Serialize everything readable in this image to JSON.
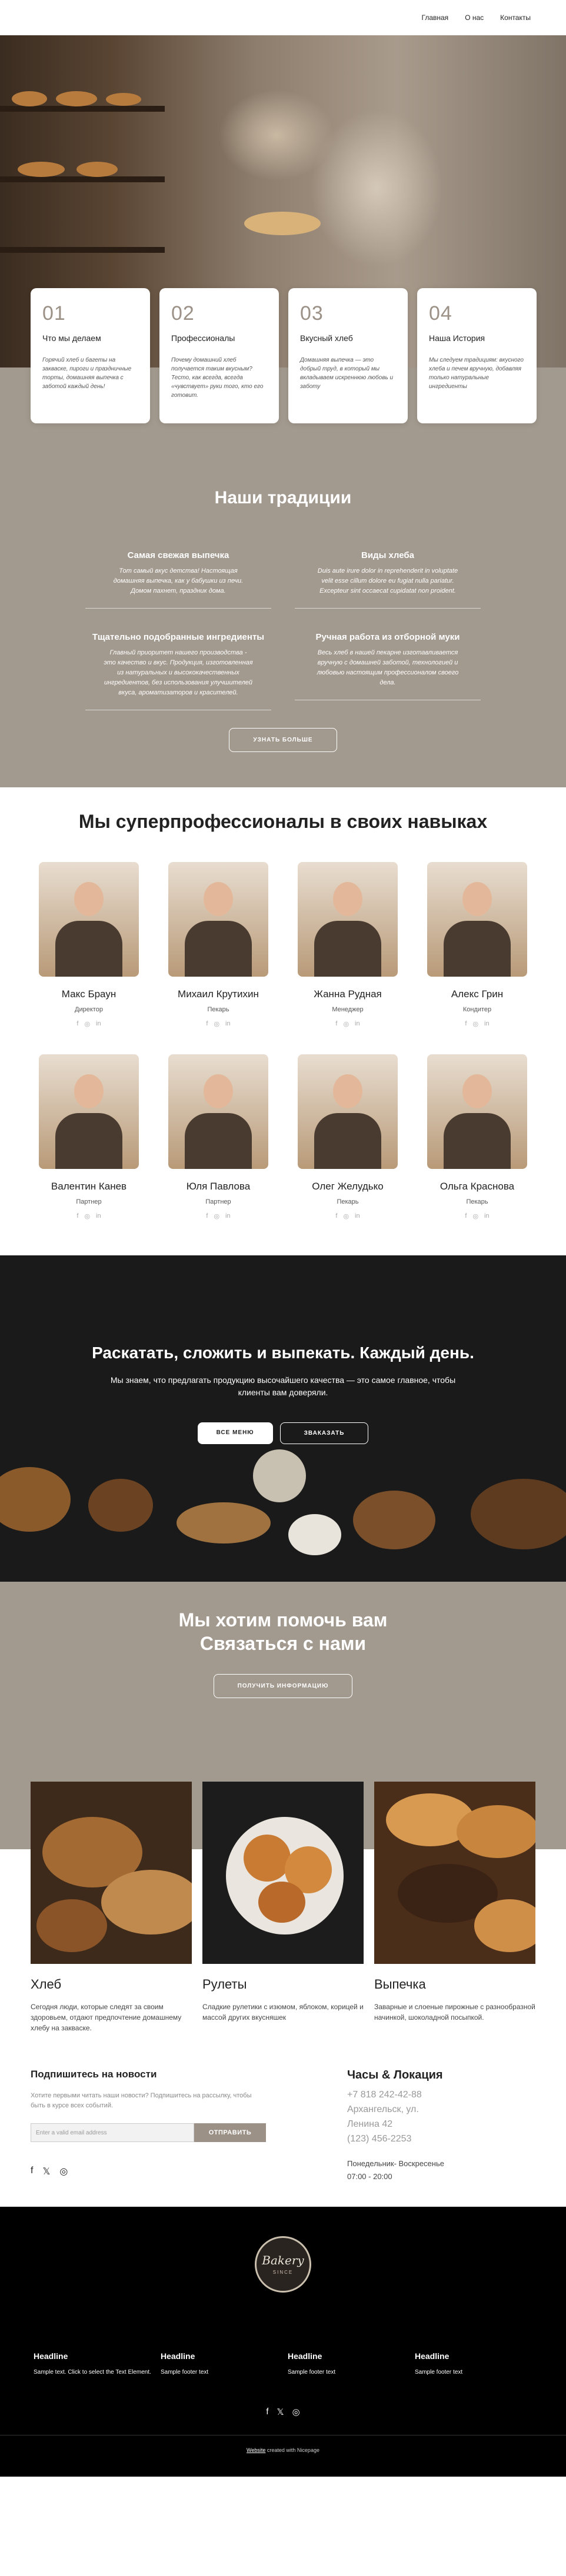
{
  "nav": {
    "items": [
      "Главная",
      "О нас",
      "Контакты"
    ]
  },
  "features": [
    {
      "num": "01",
      "title": "Что мы делаем",
      "text": "Горячий хлеб и багеты на закваске, пироги и праздничные торты, домашняя выпечка с заботой каждый день!"
    },
    {
      "num": "02",
      "title": "Профессионалы",
      "text": "Почему домашний хлеб получается таким вкусным? Тесто, как всегда, всегда «чувствует» руки того, кто его готовит."
    },
    {
      "num": "03",
      "title": "Вкусный хлеб",
      "text": "Домашняя выпечка — это добрый труд, в который мы вкладываем искреннюю любовь и заботу"
    },
    {
      "num": "04",
      "title": "Наша История",
      "text": "Мы следуем традициям: вкусного хлеба и печем вручную, добавляя только натуральные ингредиенты"
    }
  ],
  "traditions": {
    "title": "Наши традиции",
    "items": [
      {
        "title": "Самая свежая выпечка",
        "text": "Тот самый вкус детства! Настоящая домашняя выпечка, как у бабушки из печи. Домом пахнет, праздник дома."
      },
      {
        "title": "Виды хлеба",
        "text": "Duis aute irure dolor in reprehenderit in voluptate velit esse cillum dolore eu fugiat nulla pariatur. Excepteur sint occaecat cupidatat non proident."
      },
      {
        "title": "Тщательно подобранные ингредиенты",
        "text": "Главный приоритет нашего производства - это качество и вкус. Продукция, изготовленная из натуральных и высококачественных ингредиентов, без использования улучшителей вкуса, ароматизаторов и красителей."
      },
      {
        "title": "Ручная работа из отборной муки",
        "text": "Весь хлеб в нашей пекарне изготавливается вручную с домашней заботой, технологией и любовью настоящим профессионалом своего дела."
      }
    ],
    "button": "УЗНАТЬ БОЛЬШЕ"
  },
  "team": {
    "title": "Мы суперпрофессионалы в своих навыках",
    "members": [
      {
        "name": "Макс Браун",
        "role": "Директор"
      },
      {
        "name": "Михаил Крутихин",
        "role": "Пекарь"
      },
      {
        "name": "Жанна Рудная",
        "role": "Менеджер"
      },
      {
        "name": "Алекс Грин",
        "role": "Кондитер"
      },
      {
        "name": "Валентин Канев",
        "role": "Партнер"
      },
      {
        "name": "Юля Павлова",
        "role": "Партнер"
      },
      {
        "name": "Олег Желудько",
        "role": "Пекарь"
      },
      {
        "name": "Ольга Краснова",
        "role": "Пекарь"
      }
    ]
  },
  "bake": {
    "title": "Раскатать, сложить и выпекать. Каждый день.",
    "text": "Мы знаем, что предлагать продукцию высочайшего качества — это самое главное, чтобы клиенты вам доверяли.",
    "btn1": "ВСЕ МЕНЮ",
    "btn2": "ЗВАКАЗАТЬ"
  },
  "help": {
    "line1": "Мы хотим помочь вам",
    "line2": "Связаться с нами",
    "button": "ПОЛУЧИТЬ ИНФОРМАЦИЮ"
  },
  "products": [
    {
      "title": "Хлеб",
      "text": "Сегодня люди, которые следят за своим здоровьем, отдают предпочтение домашнему хлебу на закваске."
    },
    {
      "title": "Рулеты",
      "text": "Сладкие рулетики с изюмом, яблоком, корицей и массой других вкусняшек"
    },
    {
      "title": "Выпечка",
      "text": "Заварные и слоеные пирожные с разнообразной начинкой, шоколадной посыпкой."
    }
  ],
  "newsletter": {
    "title": "Подпишитесь на новости",
    "text": "Хотите первыми читать наши новости? Подпишитесь на рассылку, чтобы быть в курсе всех событий.",
    "placeholder": "Enter a valid email address",
    "button": "ОТПРАВИТЬ"
  },
  "hours": {
    "title": "Часы & Локация",
    "phone": "+7 818 242-42-88",
    "city": "Архангельск, ул.",
    "street": "Ленина 42",
    "phone2": "(123) 456-2253",
    "days": "Понедельник- Воскресенье",
    "time": "07:00 - 20:00"
  },
  "footer": {
    "logo_text": "Bakery",
    "logo_sub": "SINCE",
    "columns": [
      {
        "heading": "Headline",
        "text": "Sample text. Click to select the Text Element."
      },
      {
        "heading": "Headline",
        "text": "Sample footer text"
      },
      {
        "heading": "Headline",
        "text": "Sample footer text"
      },
      {
        "heading": "Headline",
        "text": "Sample footer text"
      }
    ],
    "credit_link": "Website",
    "credit_text": "created with Nicepage"
  },
  "colors": {
    "taupe": "#a39a8f",
    "accent": "#9c9186",
    "dark": "#1a1a1a"
  }
}
